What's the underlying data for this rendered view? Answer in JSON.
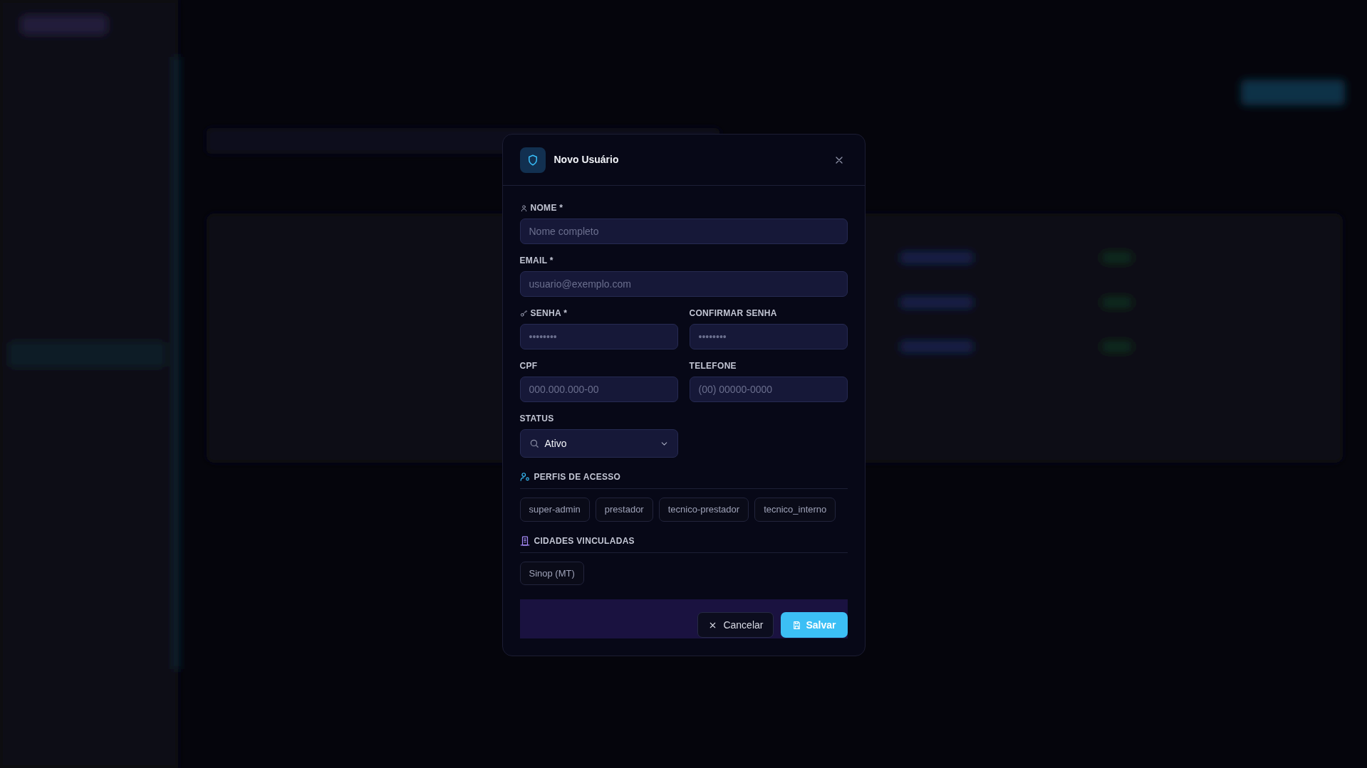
{
  "dialog": {
    "title": "Novo Usuário"
  },
  "fields": [
    {
      "kind": "text",
      "label": "NOME *",
      "placeholder": "Nome completo"
    },
    {
      "kind": "text",
      "label": "EMAIL *",
      "placeholder": "usuario@exemplo.com"
    },
    {
      "kind": "text",
      "label": "SENHA *",
      "placeholder": "••••••••"
    },
    {
      "kind": "text",
      "label": "CONFIRMAR SENHA",
      "placeholder": "••••••••"
    },
    {
      "kind": "text",
      "label": "CPF",
      "placeholder": "000.000.000-00"
    },
    {
      "kind": "text",
      "label": "TELEFONE",
      "placeholder": "(00) 00000-0000"
    },
    {
      "kind": "select",
      "label": "STATUS",
      "value": "Ativo"
    }
  ],
  "sections": [
    {
      "title": "PERFIS DE ACESSO",
      "chips": [
        {
          "label": "super-admin",
          "selected": false
        },
        {
          "label": "prestador",
          "selected": false
        },
        {
          "label": "tecnico-prestador",
          "selected": false
        },
        {
          "label": "tecnico_interno",
          "selected": false
        }
      ]
    },
    {
      "title": "CIDADES VINCULADAS",
      "chips": [
        {
          "label": "Sinop (MT)",
          "selected": false
        }
      ]
    }
  ],
  "buttons": [
    {
      "kind": "cancel",
      "label": "Cancelar"
    },
    {
      "kind": "save",
      "label": "Salvar"
    }
  ]
}
